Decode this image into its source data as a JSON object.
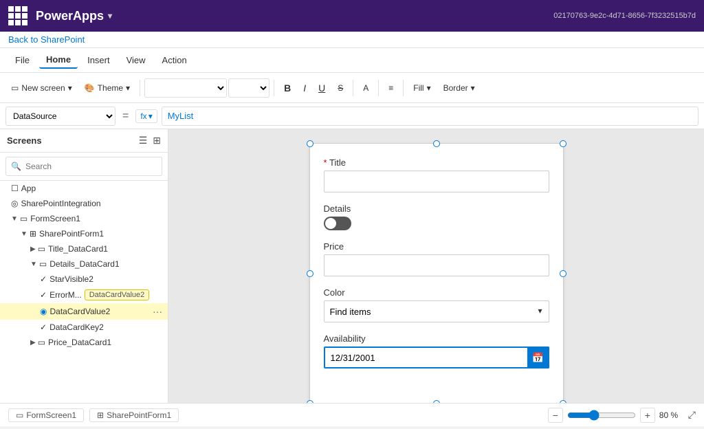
{
  "titlebar": {
    "app_name": "PowerApps",
    "chevron": "▾",
    "id": "02170763-9e2c-4d71-8656-7f3232515b7d"
  },
  "back": {
    "label": "Back to SharePoint"
  },
  "menubar": {
    "items": [
      "File",
      "Home",
      "Insert",
      "View",
      "Action"
    ]
  },
  "toolbar": {
    "new_screen_label": "New screen",
    "theme_label": "Theme",
    "fill_label": "Fill",
    "border_label": "Border"
  },
  "formula_bar": {
    "dropdown_value": "DataSource",
    "equals": "=",
    "fx_label": "fx",
    "formula_value": "MyList"
  },
  "sidebar": {
    "title": "Screens",
    "search_placeholder": "Search",
    "search_label": "Search",
    "items": [
      {
        "id": "app",
        "label": "App",
        "indent": 1,
        "type": "app",
        "expandable": false
      },
      {
        "id": "sharepointintegration",
        "label": "SharePointIntegration",
        "indent": 1,
        "type": "sp",
        "expandable": false
      },
      {
        "id": "formscreen1",
        "label": "FormScreen1",
        "indent": 1,
        "type": "screen",
        "expandable": true,
        "expanded": true
      },
      {
        "id": "sharepointform1",
        "label": "SharePointForm1",
        "indent": 2,
        "type": "form",
        "expandable": true,
        "expanded": true
      },
      {
        "id": "title_datacard1",
        "label": "Title_DataCard1",
        "indent": 3,
        "type": "card",
        "expandable": true,
        "expanded": false
      },
      {
        "id": "details_datacard1",
        "label": "Details_DataCard1",
        "indent": 3,
        "type": "card",
        "expandable": true,
        "expanded": true
      },
      {
        "id": "starvisible2",
        "label": "StarVisible2",
        "indent": 4,
        "type": "control"
      },
      {
        "id": "errormessage2",
        "label": "ErrorM...",
        "indent": 4,
        "type": "control"
      },
      {
        "id": "datacardvalue2",
        "label": "DataCardValue2",
        "indent": 4,
        "type": "control",
        "selected": true,
        "tooltip": "DataCardValue2"
      },
      {
        "id": "datacardkey2",
        "label": "DataCardKey2",
        "indent": 4,
        "type": "control"
      },
      {
        "id": "price_datacard1",
        "label": "Price_DataCard1",
        "indent": 3,
        "type": "card",
        "expandable": true,
        "expanded": false
      }
    ]
  },
  "canvas": {
    "form": {
      "fields": [
        {
          "id": "title",
          "label": "Title",
          "required": true,
          "type": "text",
          "value": ""
        },
        {
          "id": "details",
          "label": "Details",
          "type": "toggle",
          "value": true
        },
        {
          "id": "price",
          "label": "Price",
          "type": "text",
          "value": ""
        },
        {
          "id": "color",
          "label": "Color",
          "type": "select",
          "value": "Find items",
          "options": [
            "Find items"
          ]
        },
        {
          "id": "availability",
          "label": "Availability",
          "type": "date",
          "value": "12/31/2001"
        }
      ]
    }
  },
  "statusbar": {
    "tabs": [
      {
        "label": "FormScreen1",
        "active": false
      },
      {
        "label": "SharePointForm1",
        "active": false
      }
    ],
    "zoom_minus": "−",
    "zoom_plus": "+",
    "zoom_value": "80 %",
    "fit_icon": "⤢"
  }
}
